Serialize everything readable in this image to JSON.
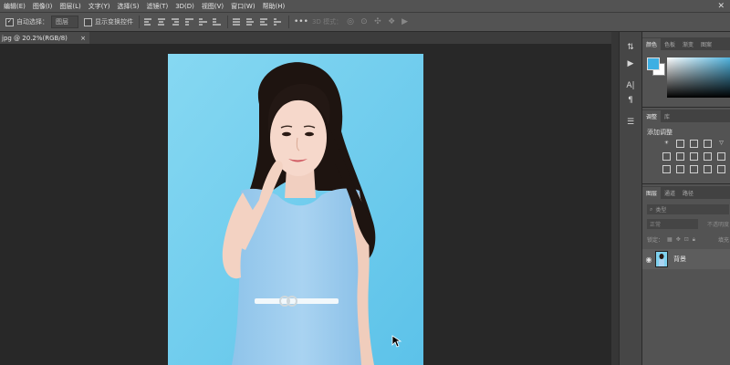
{
  "menu": [
    "编辑(E)",
    "图像(I)",
    "图层(L)",
    "文字(Y)",
    "选择(S)",
    "滤镜(T)",
    "3D(D)",
    "视图(V)",
    "窗口(W)",
    "帮助(H)"
  ],
  "options": {
    "auto_select_label": "自动选择：",
    "auto_select_value": "图层",
    "show_transform_label": "显示变换控件",
    "mode_3d": "3D 模式："
  },
  "document": {
    "tab_title": "jpg @ 20.2%(RGB/8)",
    "close_glyph": "×"
  },
  "panels": {
    "color_tabs": [
      "颜色",
      "色板",
      "渐变",
      "图案"
    ],
    "adjust_tabs": [
      "调整",
      "库"
    ],
    "adjust_title": "添加调整",
    "layers_tabs": [
      "图层",
      "通道",
      "路径"
    ],
    "search_placeholder": "类型",
    "blend_mode": "正常",
    "opacity_label": "不透明度",
    "lock_label": "锁定：",
    "fill_label": "填充",
    "layer_name": "背景"
  },
  "colors": {
    "foreground": "#3dafe3",
    "background": "#ffffff",
    "photo_bg": "#7fd2ef"
  },
  "icons": [
    "checkbox-icon",
    "align-icon",
    "more-icon",
    "3d-orbit-icon",
    "eye-icon",
    "cursor-icon",
    "lock-icon",
    "play-icon",
    "type-icon",
    "paragraph-icon",
    "adjustments-icon"
  ]
}
